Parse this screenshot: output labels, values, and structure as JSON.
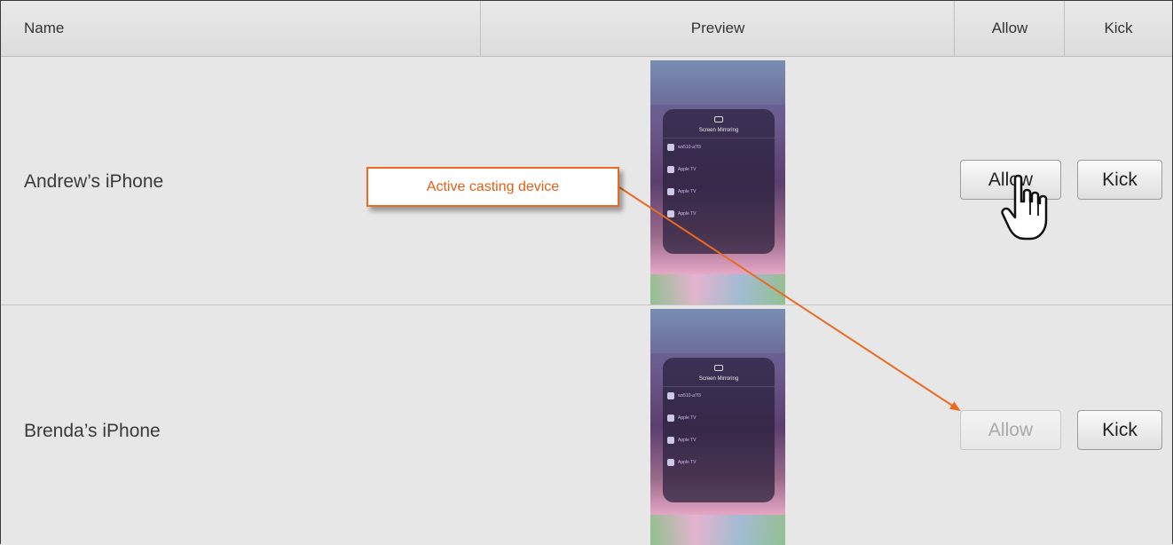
{
  "columns": {
    "name": "Name",
    "preview": "Preview",
    "allow": "Allow",
    "kick": "Kick"
  },
  "rows": [
    {
      "device_name": "Andrew’s iPhone",
      "allow_label": "Allow",
      "allow_enabled": true,
      "kick_label": "Kick",
      "preview": {
        "title": "Screen Mirroring",
        "items": [
          "ws510-a7f3",
          "Apple TV",
          "Apple TV",
          "Apple TV"
        ]
      }
    },
    {
      "device_name": "Brenda’s iPhone",
      "allow_label": "Allow",
      "allow_enabled": false,
      "kick_label": "Kick",
      "preview": {
        "title": "Screen Mirroring",
        "items": [
          "ws510-a7f3",
          "Apple TV",
          "Apple TV",
          "Apple TV"
        ]
      }
    }
  ],
  "callout": {
    "text": "Active casting device"
  },
  "colors": {
    "accent": "#ec6a22",
    "callout_text": "#e35f12"
  },
  "cursor_icon": "hand-pointer-icon"
}
